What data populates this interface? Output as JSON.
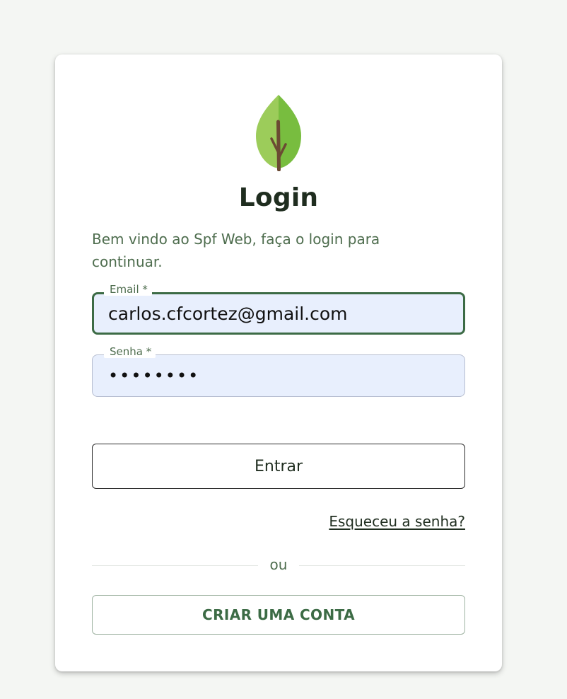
{
  "login": {
    "logo_icon": "leaf-icon",
    "title": "Login",
    "subtitle": "Bem vindo ao Spf Web, faça o login para continuar.",
    "email": {
      "label": "Email *",
      "value": "carlos.cfcortez@gmail.com"
    },
    "password": {
      "label": "Senha *",
      "value_masked": "••••••••"
    },
    "submit_label": "Entrar",
    "forgot_label": "Esqueceu a senha?",
    "divider_label": "ou",
    "create_account_label": "CRIAR UMA CONTA"
  },
  "colors": {
    "brand_green": "#3c6b45",
    "text_muted_green": "#4e6d4e",
    "input_background": "#e8effd",
    "page_background": "#f4f6f3"
  }
}
